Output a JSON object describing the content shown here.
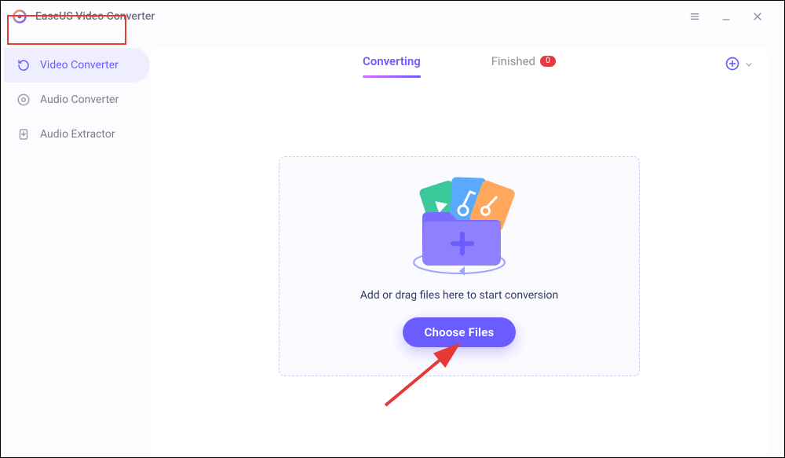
{
  "app": {
    "title": "EaseUS Video Converter"
  },
  "sidebar": {
    "items": [
      {
        "label": "Video Converter",
        "icon": "video-convert-icon",
        "active": true
      },
      {
        "label": "Audio Converter",
        "icon": "audio-convert-icon",
        "active": false
      },
      {
        "label": "Audio Extractor",
        "icon": "audio-extract-icon",
        "active": false
      }
    ]
  },
  "tabs": {
    "converting": {
      "label": "Converting",
      "active": true
    },
    "finished": {
      "label": "Finished",
      "badge": "0",
      "active": false
    }
  },
  "dropzone": {
    "prompt": "Add or drag files here to start conversion",
    "button": "Choose Files"
  },
  "colors": {
    "accent": "#6a5cff",
    "badge": "#e53a40",
    "highlight": "#e23b30"
  }
}
